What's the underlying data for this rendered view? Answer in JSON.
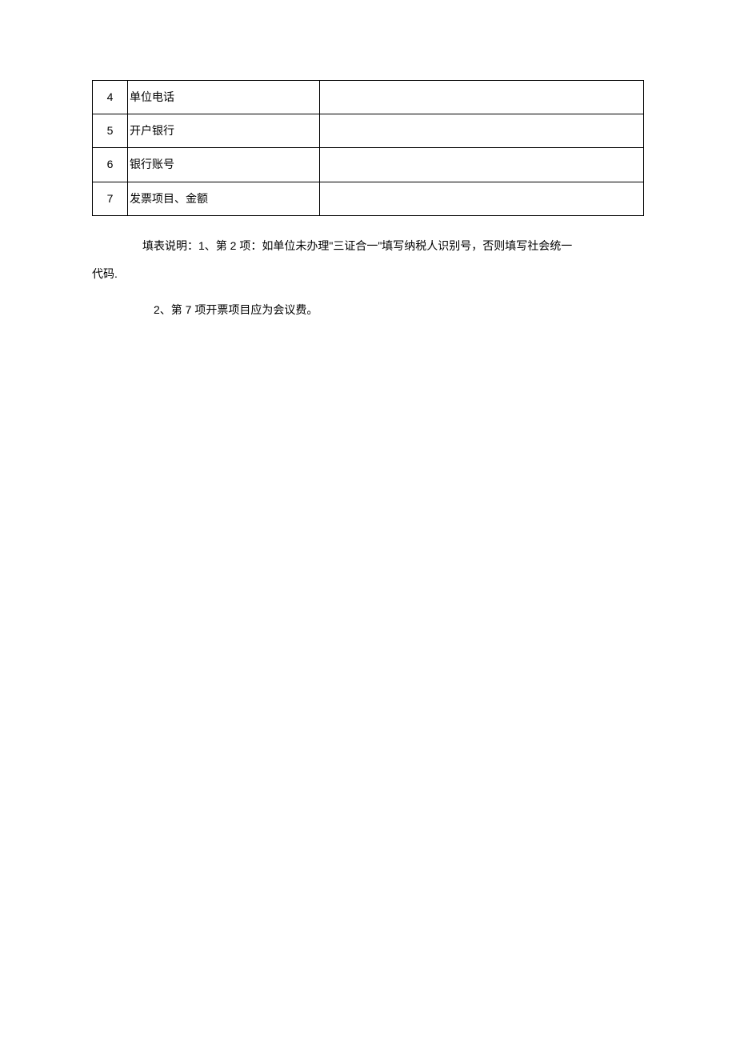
{
  "table": {
    "rows": [
      {
        "num": "4",
        "label": "单位电话",
        "value": ""
      },
      {
        "num": "5",
        "label": "开户银行",
        "value": ""
      },
      {
        "num": "6",
        "label": "银行账号",
        "value": ""
      },
      {
        "num": "7",
        "label": "发票项目、金额",
        "value": ""
      }
    ]
  },
  "notes": {
    "line1": "填表说明：1、第 2 项：如单位未办理\"三证合一\"填写纳税人识别号，否则填写社会统一",
    "line2": "代码.",
    "line3": "2、第 7 项开票项目应为会议费。"
  }
}
